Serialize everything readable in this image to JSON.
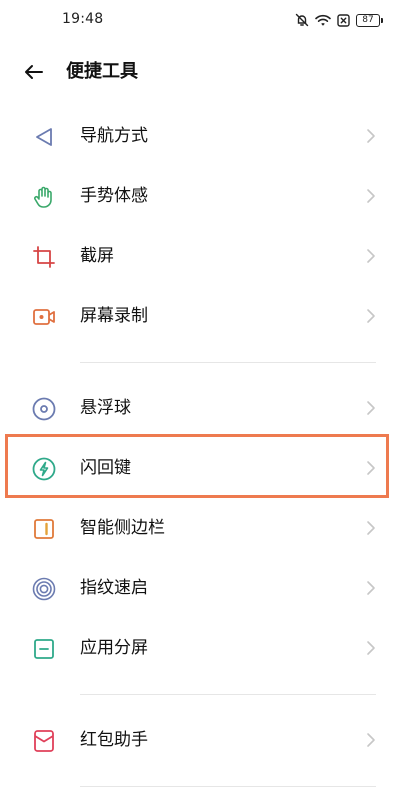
{
  "status": {
    "time": "19:48",
    "battery": "87"
  },
  "header": {
    "title": "便捷工具"
  },
  "items": [
    {
      "label": "导航方式",
      "icon": "navigation-icon"
    },
    {
      "label": "手势体感",
      "icon": "gesture-hand-icon"
    },
    {
      "label": "截屏",
      "icon": "screenshot-crop-icon"
    },
    {
      "label": "屏幕录制",
      "icon": "screen-record-icon"
    },
    {
      "label": "悬浮球",
      "icon": "floating-ball-icon"
    },
    {
      "label": "闪回键",
      "icon": "flashback-lightning-icon"
    },
    {
      "label": "智能侧边栏",
      "icon": "smart-sidebar-icon"
    },
    {
      "label": "指纹速启",
      "icon": "fingerprint-icon"
    },
    {
      "label": "应用分屏",
      "icon": "split-screen-icon"
    },
    {
      "label": "红包助手",
      "icon": "red-envelope-icon"
    }
  ],
  "colors": {
    "highlight": "#ee7a4f"
  }
}
